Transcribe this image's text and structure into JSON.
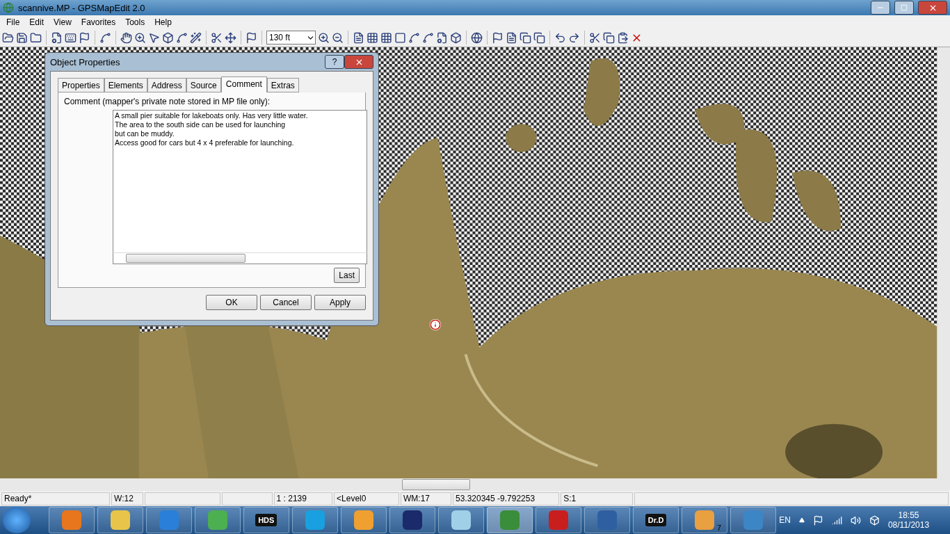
{
  "window": {
    "title": "scannive.MP - GPSMapEdit 2.0"
  },
  "menu": [
    "File",
    "Edit",
    "View",
    "Favorites",
    "Tools",
    "Help"
  ],
  "toolbar": {
    "scale": {
      "value": "130 ft"
    }
  },
  "dialog": {
    "title": "Object Properties",
    "help_button": "?",
    "tabs": [
      {
        "label": "Properties",
        "selected": false
      },
      {
        "label": "Elements",
        "selected": false
      },
      {
        "label": "Address",
        "selected": false
      },
      {
        "label": "Source",
        "selected": false
      },
      {
        "label": "Comment",
        "selected": true
      },
      {
        "label": "Extras",
        "selected": false
      }
    ],
    "comment_label": "Comment (mapper's private note stored in MP file only):",
    "comment": {
      "value": "A small pier suitable for lakeboats only. Has very little water.\nThe area to the south side can be used for launching\nbut can be muddy.\nAccess good for cars but 4 x 4 preferable for launching.\n"
    },
    "last_button": "Last",
    "buttons": [
      "OK",
      "Cancel",
      "Apply"
    ]
  },
  "status_bar": [
    {
      "kind": "text",
      "text": "Ready*"
    },
    {
      "kind": "text",
      "text": "W:12"
    },
    {
      "kind": "blank"
    },
    {
      "kind": "blank"
    },
    {
      "kind": "text",
      "text": "1 : 2139"
    },
    {
      "kind": "text",
      "text": "<Level0"
    },
    {
      "kind": "text",
      "text": "WM:17"
    },
    {
      "kind": "text",
      "text": "53.320345 -9.792253"
    },
    {
      "kind": "text",
      "text": "S:1"
    },
    {
      "kind": "blank"
    }
  ],
  "taskbar": {
    "apps": [
      {
        "kind": "icon",
        "selected": false
      },
      {
        "kind": "icon",
        "selected": false
      },
      {
        "kind": "icon",
        "selected": false
      },
      {
        "kind": "icon",
        "selected": false
      },
      {
        "kind": "label",
        "label": "HDS",
        "selected": false
      },
      {
        "kind": "icon",
        "selected": false
      },
      {
        "kind": "icon",
        "selected": false
      },
      {
        "kind": "icon",
        "selected": false
      },
      {
        "kind": "icon",
        "selected": false
      },
      {
        "kind": "icon",
        "selected": true
      },
      {
        "kind": "icon",
        "selected": false
      },
      {
        "kind": "icon",
        "selected": false
      },
      {
        "kind": "label",
        "label": "Dr.D",
        "selected": false
      },
      {
        "kind": "badge",
        "badge": "7",
        "selected": false
      },
      {
        "kind": "icon",
        "selected": false
      }
    ],
    "language": "EN",
    "time": "18:55",
    "date": "08/11/2013"
  }
}
